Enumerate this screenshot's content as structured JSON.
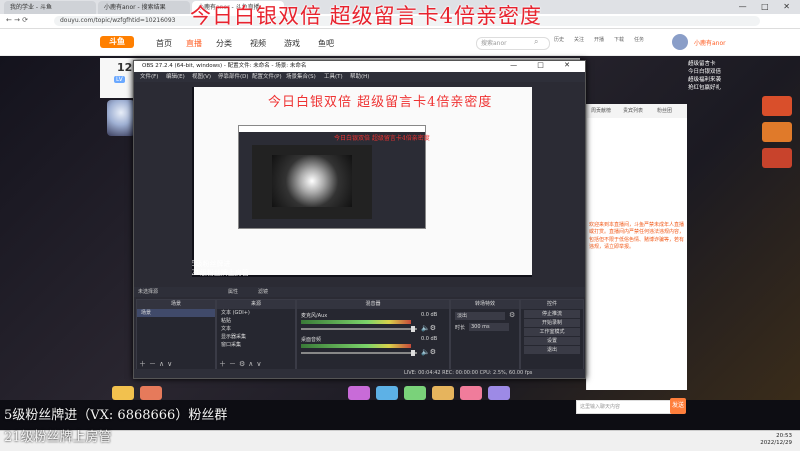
{
  "browser": {
    "tabs": [
      "我的学业 - 斗鱼",
      "小鹿有anor - 搜索结果",
      "小鹿有anor - 斗鱼直播"
    ],
    "url": "douyu.com/topic/wzfgfhtid=10216093",
    "window_controls": "— □ ✕"
  },
  "site": {
    "logo": "斗鱼",
    "nav": [
      "首页",
      "直播",
      "分类",
      "视频",
      "游戏",
      "鱼吧"
    ],
    "active_nav": "直播",
    "search_placeholder": "搜索anor",
    "header_icons": [
      "历史",
      "关注",
      "开播",
      "下载",
      "任务"
    ],
    "username": "小鹿有anor"
  },
  "room": {
    "number": "12",
    "level": "LV"
  },
  "obs": {
    "title": "OBS 27.2.4 (64-bit, windows) - 配置文件: 未命名 - 场景: 未命名",
    "menu": [
      "文件(F)",
      "编辑(E)",
      "视图(V)",
      "停靠部件(D)",
      "配置文件(P)",
      "场景集合(S)",
      "工具(T)",
      "帮助(H)"
    ],
    "preview_title": "今日白银双倍  超级留言卡4倍亲密度",
    "preview_bottom1": "5级粉丝牌进",
    "preview_bottom2": "21级粉丝牌上房管",
    "scene_bar": "未选择源",
    "scene_bar_buttons": [
      "属性",
      "滤镜"
    ],
    "docks": {
      "scenes": {
        "title": "场景",
        "items": [
          "场景"
        ]
      },
      "sources": {
        "title": "来源",
        "items": [
          "文本 (GDI+)",
          "粘贴",
          "文本",
          "显示器采集",
          "窗口采集"
        ]
      },
      "mixer": {
        "title": "混音器",
        "tracks": [
          {
            "name": "麦克风/Aux",
            "db": "0.0 dB",
            "level": 0.82
          },
          {
            "name": "桌面音频",
            "db": "0.0 dB",
            "level": 0.78
          }
        ]
      },
      "transitions": {
        "title": "转场特效",
        "type": "淡出",
        "duration_label": "时长",
        "duration": "300 ms"
      },
      "controls": {
        "title": "控件",
        "buttons": [
          "停止推流",
          "开始录制",
          "工作室模式",
          "设置",
          "退出"
        ]
      }
    },
    "status": "LIVE: 00:04:42   REC: 00:00:00   CPU: 2.5%, 60.00 fps"
  },
  "chat": {
    "tabs": [
      "周贡献榜",
      "贵宾列表",
      "粉丝团"
    ],
    "notice": "欢迎来到本直播间，斗鱼严禁未成年人直播或打赏。直播间内严禁任何违法违规内容，包括但不限于低俗色情、赌博诈骗等，若有违规，请立即举报。",
    "send_label": "发送",
    "input_placeholder": "这里输入聊天内容"
  },
  "side_ad": {
    "lines": [
      "超级留言卡",
      "今日白银双倍",
      "超级福利来袭",
      "抢红包赢好礼"
    ]
  },
  "overlay": {
    "title": "今日白银双倍  超级留言卡4倍亲密度",
    "line1": "5级粉丝牌进（VX: 6868666）粉丝群",
    "line2": "21级粉丝牌上房管"
  },
  "clock": {
    "time": "20:53",
    "date": "2022/12/29"
  },
  "colors": {
    "accent": "#ff5d23",
    "overlay_red": "#e8232e",
    "obs_bg": "#2b2b34"
  }
}
